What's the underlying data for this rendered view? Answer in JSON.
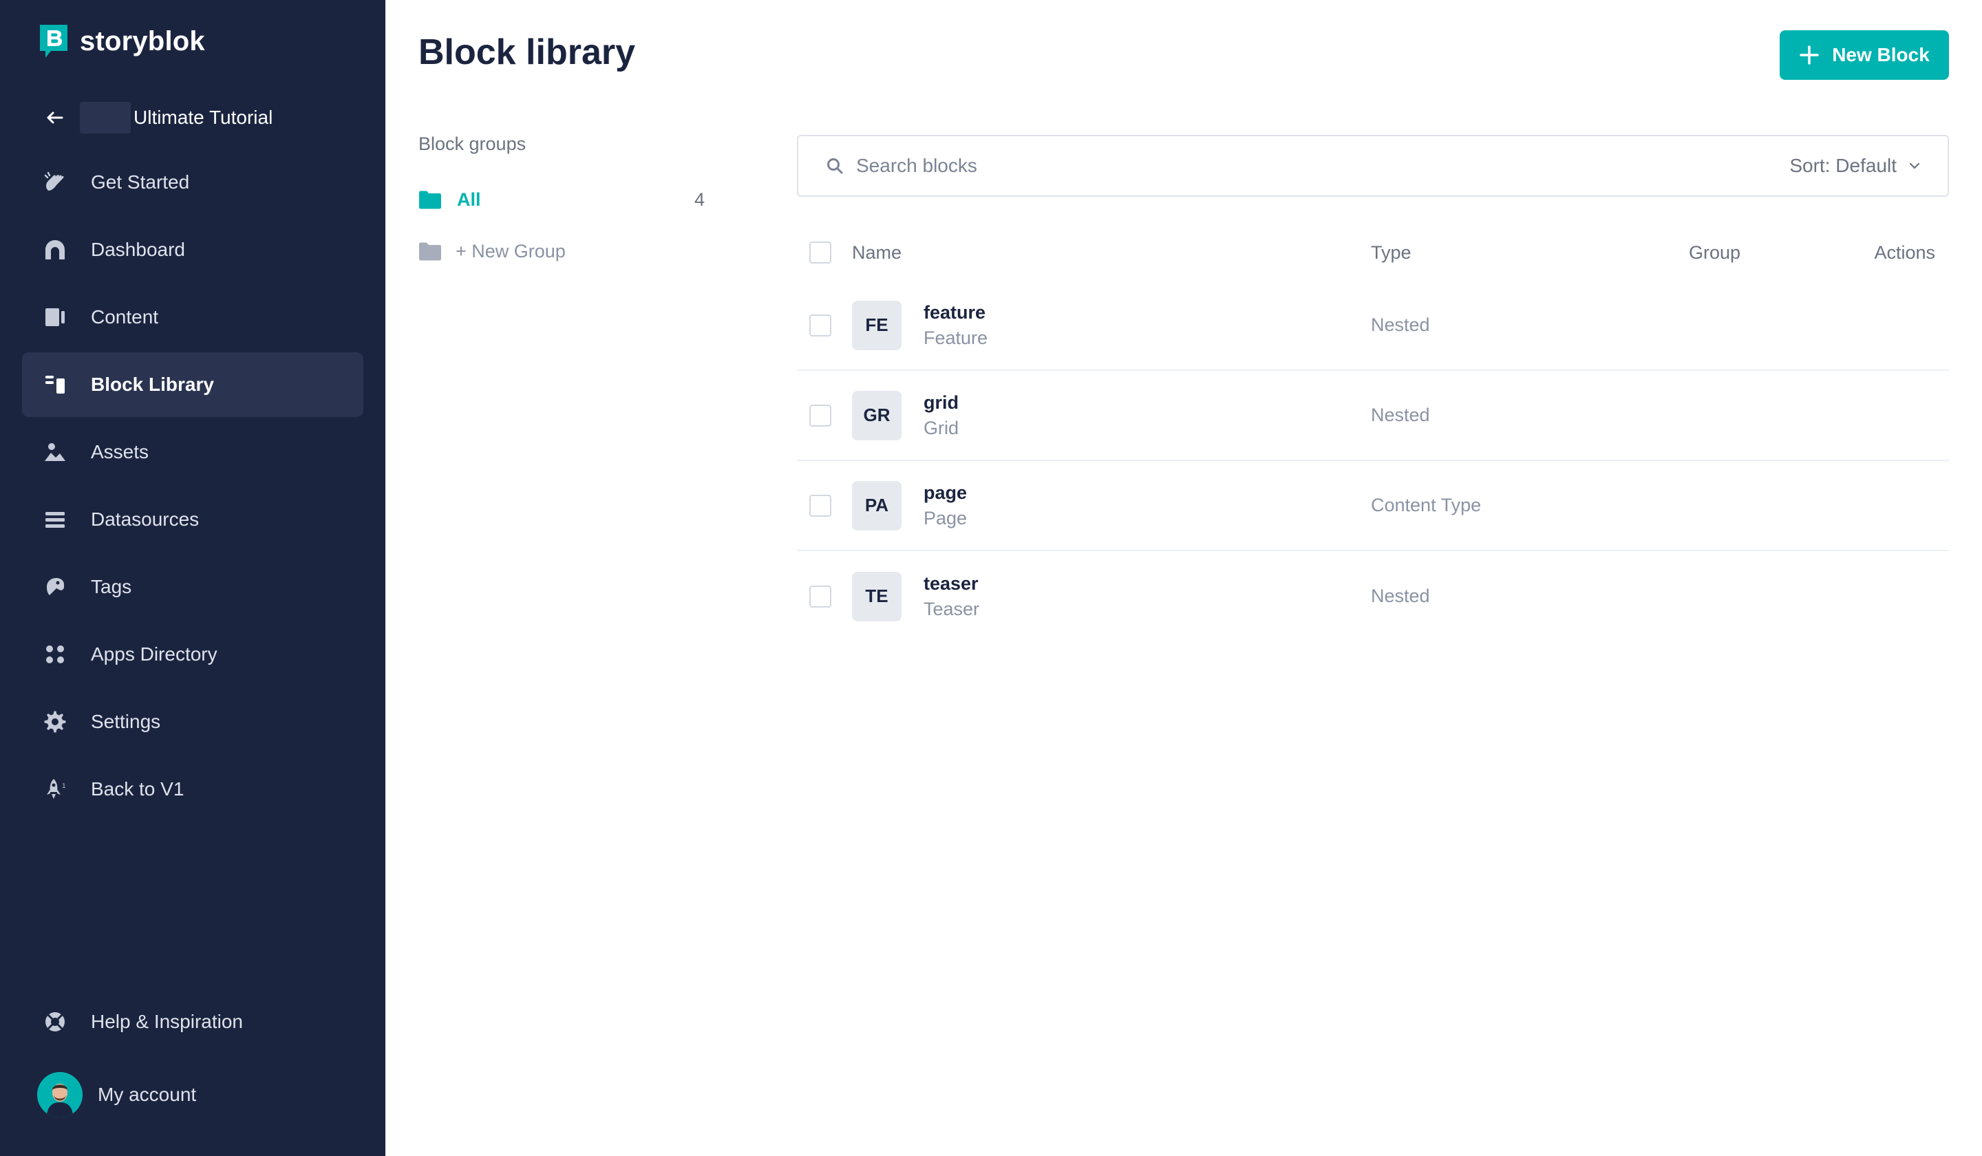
{
  "brand": {
    "name": "storyblok",
    "accent": "#00b3b0",
    "sidebar_bg": "#1b243f"
  },
  "space": {
    "name": "Ultimate Tutorial"
  },
  "nav": {
    "items": [
      {
        "label": "Get Started",
        "icon": "hand-wave-icon"
      },
      {
        "label": "Dashboard",
        "icon": "dashboard-icon"
      },
      {
        "label": "Content",
        "icon": "content-icon"
      },
      {
        "label": "Block Library",
        "icon": "block-library-icon",
        "active": true
      },
      {
        "label": "Assets",
        "icon": "assets-icon"
      },
      {
        "label": "Datasources",
        "icon": "datasources-icon"
      },
      {
        "label": "Tags",
        "icon": "tags-icon"
      },
      {
        "label": "Apps Directory",
        "icon": "apps-icon"
      },
      {
        "label": "Settings",
        "icon": "gear-icon"
      },
      {
        "label": "Back to V1",
        "icon": "rocket-icon"
      }
    ],
    "help": {
      "label": "Help & Inspiration",
      "icon": "lifebuoy-icon"
    },
    "account": {
      "label": "My account"
    }
  },
  "page": {
    "title": "Block library",
    "new_block_label": "New Block"
  },
  "groups": {
    "heading": "Block groups",
    "all_label": "All",
    "all_count": "4",
    "new_group_label": "+ New Group"
  },
  "search": {
    "placeholder": "Search blocks",
    "sort_label": "Sort: Default"
  },
  "table": {
    "columns": [
      "Name",
      "Type",
      "Group",
      "Actions"
    ],
    "rows": [
      {
        "badge": "FE",
        "name": "feature",
        "display": "Feature",
        "type": "Nested"
      },
      {
        "badge": "GR",
        "name": "grid",
        "display": "Grid",
        "type": "Nested"
      },
      {
        "badge": "PA",
        "name": "page",
        "display": "Page",
        "type": "Content Type"
      },
      {
        "badge": "TE",
        "name": "teaser",
        "display": "Teaser",
        "type": "Nested"
      }
    ]
  }
}
